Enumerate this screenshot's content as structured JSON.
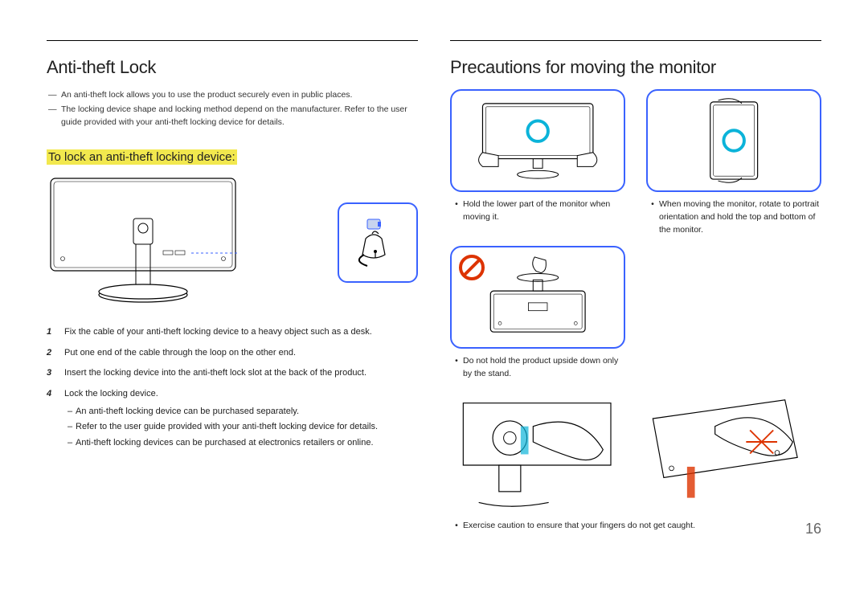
{
  "page_number": "16",
  "left": {
    "heading": "Anti-theft Lock",
    "notes": [
      "An anti-theft lock allows you to use the product securely even in public places.",
      "The locking device shape and locking method depend on the manufacturer. Refer to the user guide provided with your anti-theft locking device for details."
    ],
    "subheading": "To lock an anti-theft locking device:",
    "steps": [
      {
        "n": "1",
        "text": "Fix the cable of your anti-theft locking device to a heavy object such as a desk."
      },
      {
        "n": "2",
        "text": "Put one end of the cable through the loop on the other end."
      },
      {
        "n": "3",
        "text": "Insert the locking device into the anti-theft lock slot at the back of the product."
      },
      {
        "n": "4",
        "text": "Lock the locking device.",
        "sub": [
          "An anti-theft locking device can be purchased separately.",
          "Refer to the user guide provided with your anti-theft locking device for details.",
          "Anti-theft locking devices can be purchased at electronics retailers or online."
        ]
      }
    ]
  },
  "right": {
    "heading": "Precautions for moving the monitor",
    "cells": [
      {
        "caption": "Hold the lower part of the monitor when moving it."
      },
      {
        "caption": "When moving the monitor, rotate to portrait orientation and hold the top and bottom of the monitor."
      }
    ],
    "warn_caption": "Do not hold the product upside down only by the stand.",
    "bottom_caption": "Exercise caution to ensure that your fingers do not get caught."
  },
  "icons": {
    "correct": "check-circle",
    "prohibit": "no-sign"
  }
}
